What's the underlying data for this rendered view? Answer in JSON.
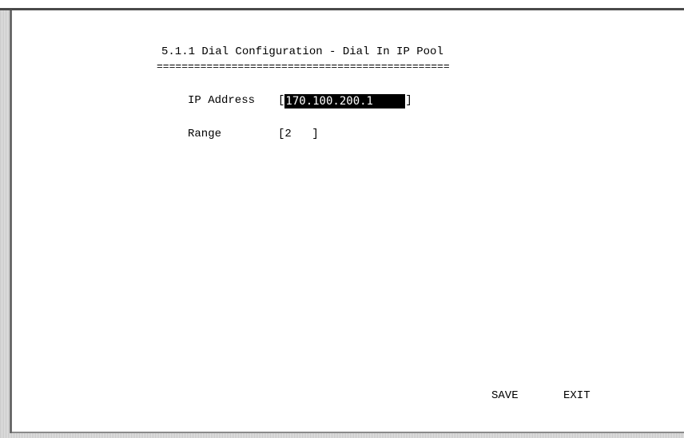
{
  "screen": {
    "title": "5.1.1 Dial Configuration - Dial In IP Pool",
    "title_underline": "==============================================="
  },
  "form": {
    "ip_address": {
      "label": "IP Address",
      "value": "170.100.200.1"
    },
    "range": {
      "label": "Range",
      "value": "2"
    }
  },
  "actions": {
    "save_label": "SAVE",
    "exit_label": "EXIT"
  },
  "colors": {
    "background": "#ffffff",
    "text": "#000000",
    "selected_field_bg": "#000000",
    "selected_field_text": "#ffffff"
  }
}
